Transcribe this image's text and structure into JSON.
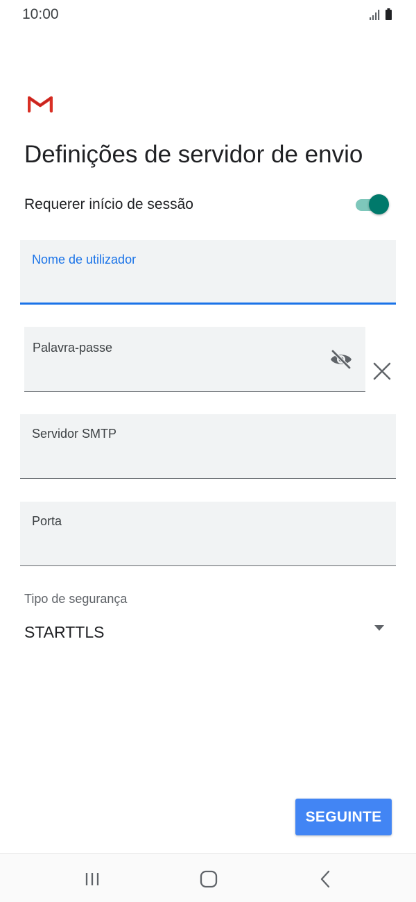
{
  "status_bar": {
    "time": "10:00",
    "icons": [
      "signal-icon",
      "battery-icon"
    ]
  },
  "header": {
    "logo": "gmail-logo",
    "title": "Definições de servidor de envio"
  },
  "login_required": {
    "label": "Requerer início de sessão",
    "enabled": true
  },
  "fields": {
    "username": {
      "label": "Nome de utilizador",
      "value": "",
      "state": "focused"
    },
    "password": {
      "label": "Palavra-passe",
      "value": "",
      "icons": [
        "visibility-off-icon",
        "clear-icon"
      ]
    },
    "smtp_server": {
      "label": "Servidor SMTP",
      "value": ""
    },
    "port": {
      "label": "Porta",
      "value": ""
    }
  },
  "security": {
    "label": "Tipo de segurança",
    "selected": "STARTTLS"
  },
  "actions": {
    "next_label": "SEGUINTE"
  },
  "nav_bar": {
    "buttons": [
      "recents-icon",
      "home-icon",
      "back-icon"
    ]
  },
  "colors": {
    "accent_blue": "#1a73e8",
    "button_blue": "#4285f4",
    "toggle_teal": "#00796b",
    "field_background": "#f1f3f4"
  }
}
